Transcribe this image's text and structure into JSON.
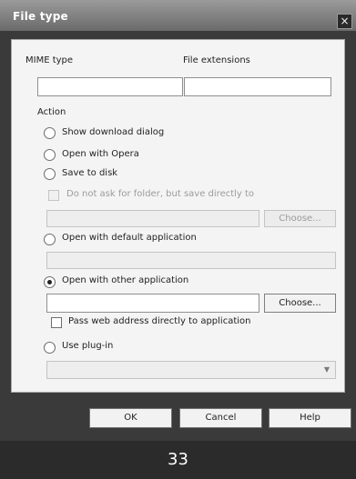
{
  "window": {
    "title": "File type",
    "close_icon": "×"
  },
  "fields": {
    "mime_label": "MIME type",
    "ext_label": "File extensions",
    "mime_value": "",
    "ext_value": ""
  },
  "action": {
    "heading": "Action",
    "options": {
      "show_download": "Show download dialog",
      "open_with_opera": "Open with Opera",
      "save_to_disk": "Save to disk",
      "open_default": "Open with default application",
      "open_other": "Open with other application",
      "use_plugin": "Use plug-in"
    },
    "selected": "open_other",
    "do_not_ask": "Do not ask for folder, but save directly to",
    "pass_web_address": "Pass web address directly to application",
    "choose_label": "Choose..."
  },
  "footer": {
    "ok": "OK",
    "cancel": "Cancel",
    "help": "Help"
  },
  "page_number": "33"
}
